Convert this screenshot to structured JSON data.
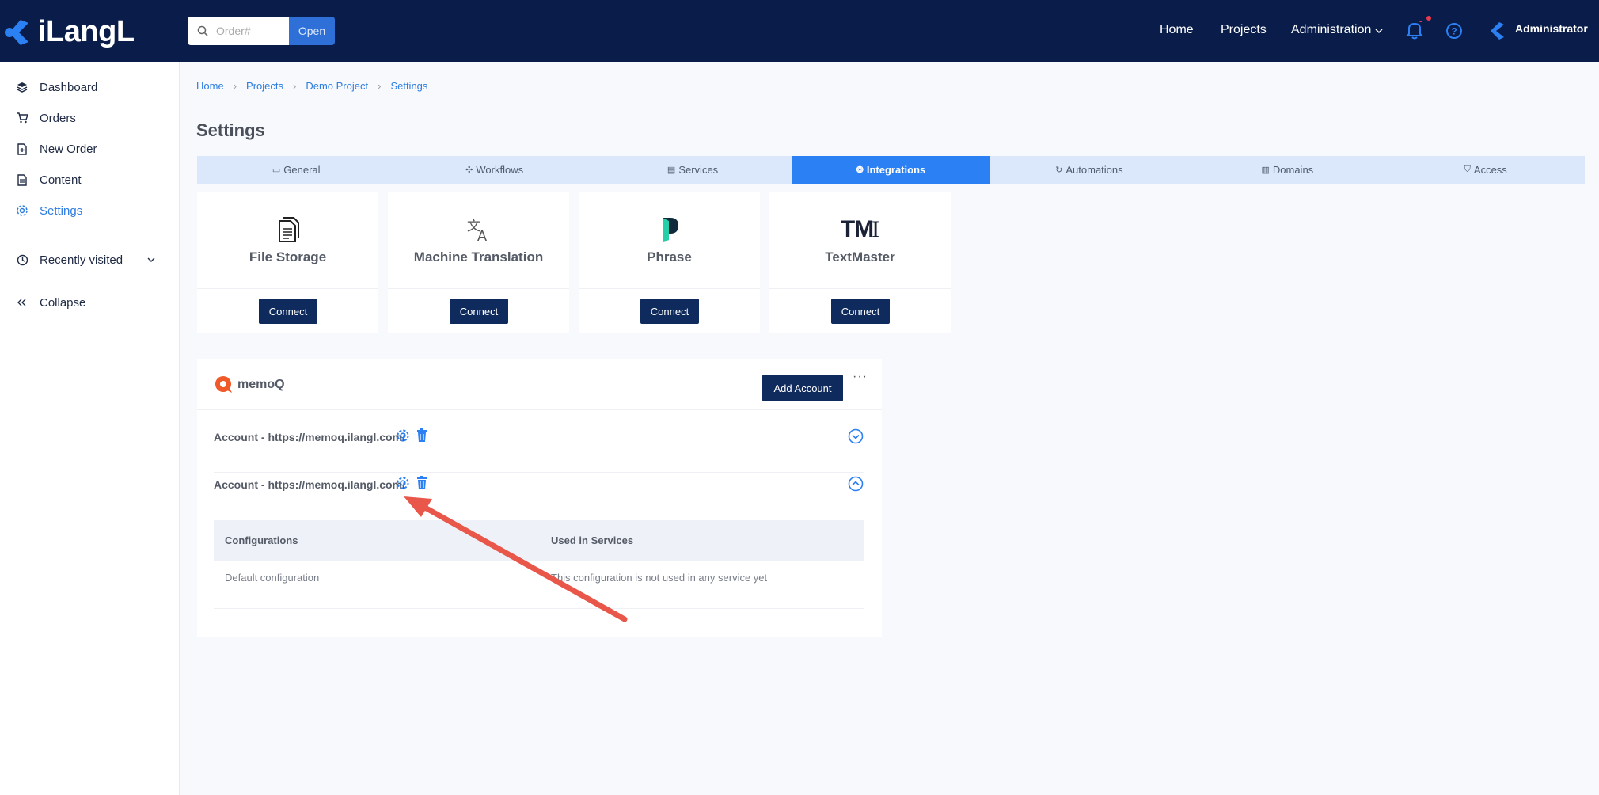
{
  "topbar": {
    "brand": "iLangL",
    "search_placeholder": "Order#",
    "open_label": "Open",
    "nav": [
      "Home",
      "Projects",
      "Administration"
    ],
    "user": "Administrator"
  },
  "sidebar": {
    "items": [
      {
        "label": "Dashboard",
        "icon": "layers-icon"
      },
      {
        "label": "Orders",
        "icon": "cart-icon"
      },
      {
        "label": "New Order",
        "icon": "file-plus-icon"
      },
      {
        "label": "Content",
        "icon": "document-icon"
      },
      {
        "label": "Settings",
        "icon": "gear-icon"
      }
    ],
    "recently_visited": "Recently visited",
    "collapse": "Collapse"
  },
  "breadcrumb": [
    "Home",
    "Projects",
    "Demo Project",
    "Settings"
  ],
  "page_title": "Settings",
  "tabs": [
    "General",
    "Workflows",
    "Services",
    "Integrations",
    "Automations",
    "Domains",
    "Access"
  ],
  "active_tab": "Integrations",
  "integrations": [
    {
      "name": "File Storage",
      "button": "Connect"
    },
    {
      "name": "Machine Translation",
      "button": "Connect"
    },
    {
      "name": "Phrase",
      "button": "Connect"
    },
    {
      "name": "TextMaster",
      "button": "Connect"
    }
  ],
  "textmaster_logo": "TM",
  "memoq": {
    "name": "memoQ",
    "add_account": "Add Account",
    "accounts": [
      {
        "label": "Account - https://memoq.ilangl.com/",
        "expanded": false
      },
      {
        "label": "Account - https://memoq.ilangl.com/",
        "expanded": true
      }
    ],
    "table": {
      "headers": [
        "Configurations",
        "Used in Services"
      ],
      "rows": [
        [
          "Default configuration",
          "This configuration is not used in any service yet"
        ]
      ]
    }
  },
  "colors": {
    "navy": "#0a1d4a",
    "accent": "#2b80f3",
    "arrow": "#e8574a",
    "memoq": "#f05a28"
  }
}
